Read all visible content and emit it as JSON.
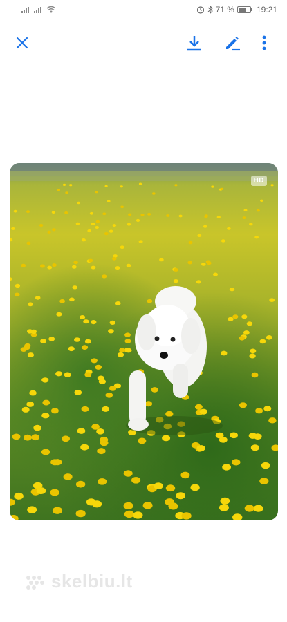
{
  "status_bar": {
    "battery_percent": "71 %",
    "battery_level": 0.71,
    "time": "19:21",
    "icons": [
      "signal-icon",
      "signal-icon",
      "wifi-icon",
      "alarm-icon",
      "bluetooth-icon",
      "battery-icon"
    ]
  },
  "toolbar": {
    "close_icon": "close-icon",
    "download_icon": "download-icon",
    "edit_icon": "edit-icon",
    "more_icon": "more-vertical-icon",
    "icon_color": "#1a73e8"
  },
  "photo": {
    "hd_badge": "HD",
    "subject": "white dog in dandelion field"
  },
  "watermark": {
    "text": "skelbiu.lt"
  }
}
